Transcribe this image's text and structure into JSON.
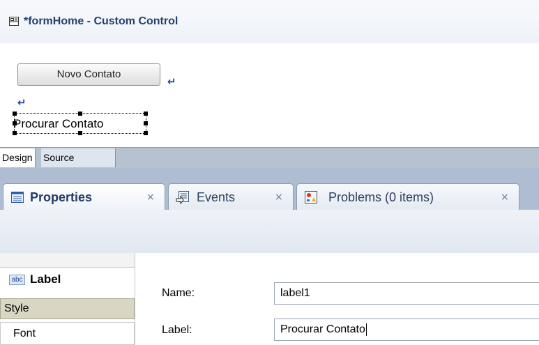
{
  "editor": {
    "title": "*formHome - Custom Control",
    "button_label": "Novo Contato",
    "return_mark": "↵",
    "selected_label_text": "Procurar Contato"
  },
  "design_tabs": {
    "design": "Design",
    "source": "Source"
  },
  "view_tabs": [
    {
      "label": "Properties",
      "icon": "properties-icon",
      "close": "×"
    },
    {
      "label": "Events",
      "icon": "events-icon",
      "close": "×"
    },
    {
      "label": "Problems (0 items)",
      "icon": "problems-icon",
      "close": "×"
    }
  ],
  "properties": {
    "sidebar": {
      "header_label": "Label",
      "header_icon_text": "abc",
      "style": "Style",
      "font": "Font"
    },
    "fields": {
      "name_label": "Name:",
      "name_value": "label1",
      "label_label": "Label:",
      "label_value": "Procurar Contato"
    }
  },
  "colors": {
    "title_text": "#25406b",
    "tab_strip": "#aebdd1",
    "style_row": "#d9d7c4"
  }
}
